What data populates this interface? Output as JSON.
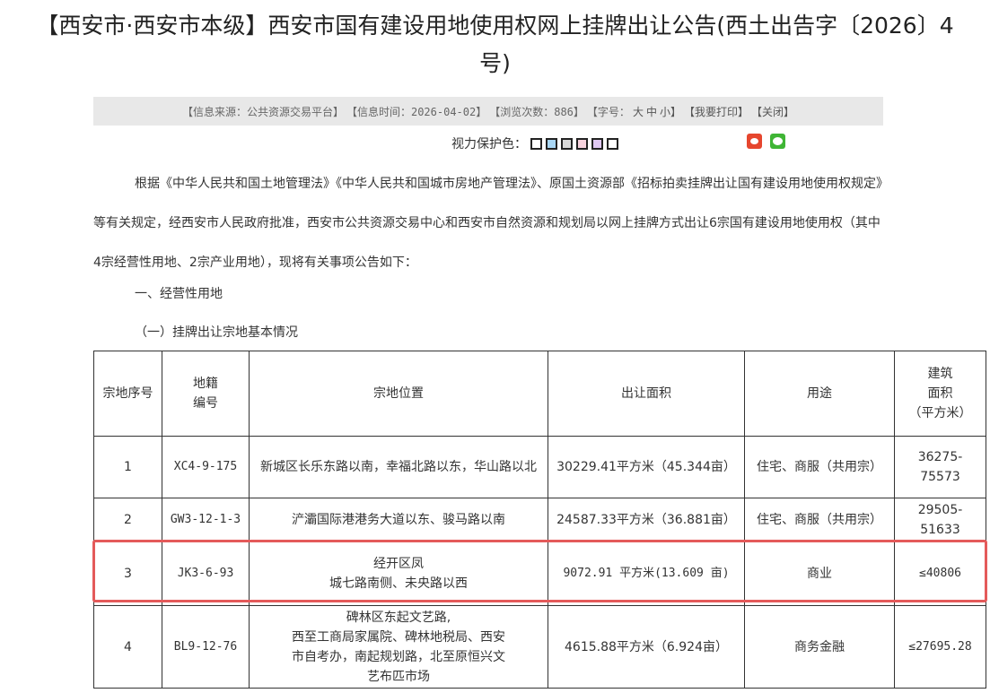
{
  "title_line1": "【西安市·西安市本级】西安市国有建设用地使用权网上挂牌出让公告(西土出告字〔2026〕4",
  "title_line2": "号)",
  "infobar": {
    "source": "【信息来源：公共资源交易平台】",
    "time": "【信息时间：2026-04-02】",
    "views": "【浏览次数：886】",
    "font_label": "【字号：",
    "font_large": "大",
    "font_medium": "中",
    "font_small": "小】",
    "print": "【我要打印】",
    "close": "【关闭】"
  },
  "eye_protect": {
    "label": "视力保护色：",
    "swatches": [
      "#ffffff",
      "#a9d7f5",
      "#d9d9d9",
      "#f8d3de",
      "#e0c8f3",
      "#ffffff"
    ]
  },
  "paragraph": "根据《中华人民共和国土地管理法》《中华人民共和国城市房地产管理法》、原国土资源部《招标拍卖挂牌出让国有建设用地使用权规定》等有关规定，经西安市人民政府批准，西安市公共资源交易中心和西安市自然资源和规划局以网上挂牌方式出让6宗国有建设用地使用权（其中4宗经营性用地、2宗产业用地），现将有关事项公告如下：",
  "section1": "一、经营性用地",
  "section2": "（一）挂牌出让宗地基本情况",
  "table": {
    "headers": {
      "seq": "宗地序号",
      "code_l1": "地籍",
      "code_l2": "编号",
      "location": "宗地位置",
      "area": "出让面积",
      "use": "用途",
      "build_l1": "建筑",
      "build_l2": "面积",
      "build_l3": "（平方米）"
    },
    "rows": [
      {
        "seq": "1",
        "code": "XC4-9-175",
        "location": [
          "新城区长乐东路以南，幸福北路以东，华山路以北"
        ],
        "area": "30229.41平方米（45.344亩）",
        "use": "住宅、商服（共用宗）",
        "build": "36275-75573"
      },
      {
        "seq": "2",
        "code": "GW3-12-1-3",
        "location": [
          "浐灞国际港港务大道以东、骏马路以南"
        ],
        "area": "24587.33平方米（36.881亩）",
        "use": "住宅、商服（共用宗）",
        "build": "29505-51633"
      },
      {
        "seq": "3",
        "code": "JK3-6-93",
        "location": [
          "经开区凤",
          "城七路南侧、未央路以西"
        ],
        "area": "9072.91 平方米(13.609 亩)",
        "use": "商业",
        "build": "≤40806"
      },
      {
        "seq": "4",
        "code": "BL9-12-76",
        "location": [
          "碑林区东起文艺路,",
          "西至工商局家属院、碑林地税局、西安",
          "市自考办，南起规划路，北至原恒兴文",
          "艺布匹市场"
        ],
        "area": "4615.88平方米（6.924亩）",
        "use": "商务金融",
        "build": "≤27695.28"
      }
    ]
  }
}
